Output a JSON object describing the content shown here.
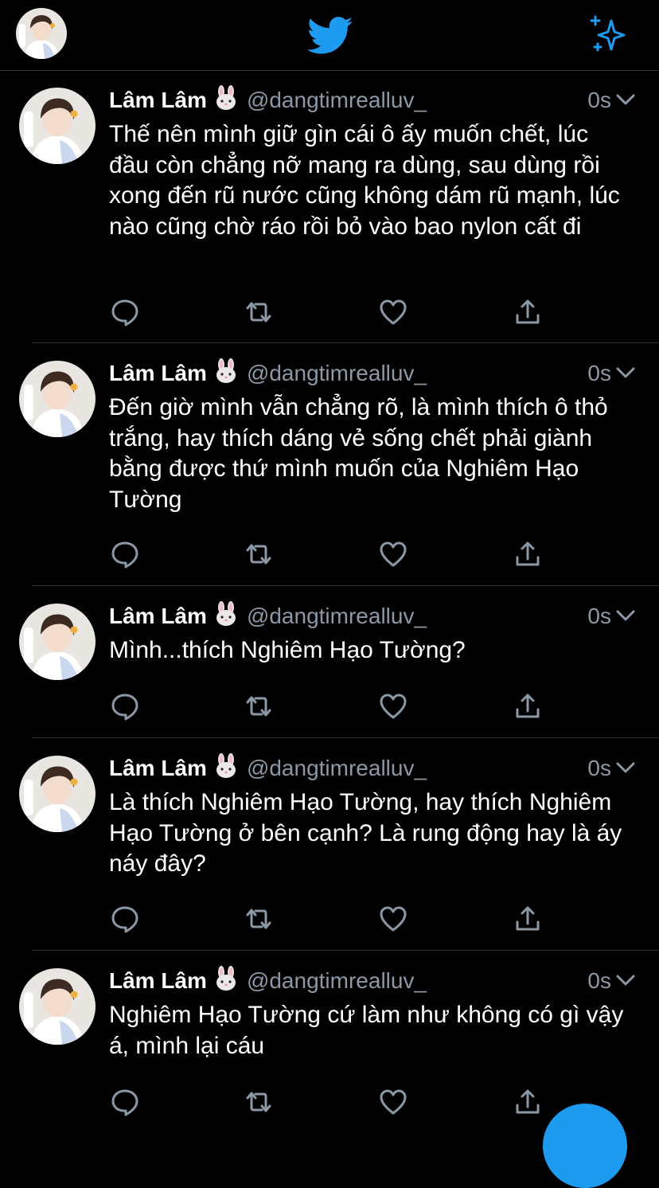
{
  "app": {
    "name": "Twitter",
    "accent_color": "#1d9bf0",
    "background": "#000000",
    "icons": {
      "logo": "twitter-bird-icon",
      "top_right": "sparkle-icon",
      "reply": "reply-icon",
      "retweet": "retweet-icon",
      "like": "heart-icon",
      "share": "share-icon",
      "menu": "chevron-down-icon"
    }
  },
  "tweets": [
    {
      "name": "Lâm Lâm",
      "emoji": "bunny-face-icon",
      "handle": "@dangtimrealluv_",
      "time": "0s",
      "text": "Thế nên mình giữ gìn cái ô ấy muốn chết, lúc đầu còn chẳng nỡ mang ra dùng, sau dùng rồi xong đến rũ nước cũng không dám rũ mạnh, lúc nào cũng chờ ráo rồi bỏ vào bao nylon cất đi"
    },
    {
      "name": "Lâm Lâm",
      "emoji": "bunny-face-icon",
      "handle": "@dangtimrealluv_",
      "time": "0s",
      "text": "Đến giờ mình vẫn chẳng rõ, là mình thích ô thỏ trắng, hay thích dáng vẻ sống chết phải giành bằng được thứ mình muốn của Nghiêm Hạo Tường"
    },
    {
      "name": "Lâm Lâm",
      "emoji": "bunny-face-icon",
      "handle": "@dangtimrealluv_",
      "time": "0s",
      "text": "Mình...thích Nghiêm Hạo Tường?"
    },
    {
      "name": "Lâm Lâm",
      "emoji": "bunny-face-icon",
      "handle": "@dangtimrealluv_",
      "time": "0s",
      "text": "Là thích Nghiêm Hạo Tường, hay thích Nghiêm Hạo Tường ở bên cạnh? Là rung động hay là áy náy đây?"
    },
    {
      "name": "Lâm Lâm",
      "emoji": "bunny-face-icon",
      "handle": "@dangtimrealluv_",
      "time": "0s",
      "text": "Nghiêm Hạo Tường cứ làm như không có gì vậy á, mình lại cáu"
    }
  ]
}
